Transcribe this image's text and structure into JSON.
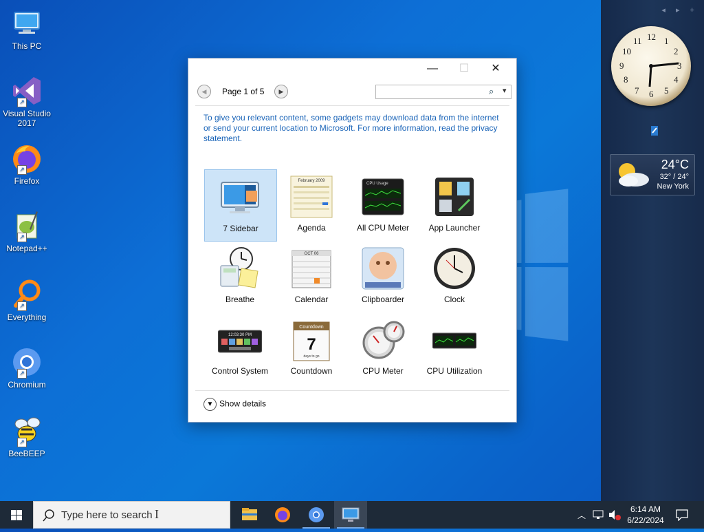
{
  "desktop": {
    "icons": [
      {
        "label": "This PC"
      },
      {
        "label": "Visual Studio 2017"
      },
      {
        "label": "Firefox"
      },
      {
        "label": "Notepad++"
      },
      {
        "label": "Everything"
      },
      {
        "label": "Chromium"
      },
      {
        "label": "BeeBEEP"
      }
    ]
  },
  "sidebar": {
    "nav": "◂ ▸ +",
    "weather": {
      "temp": "24°C",
      "range": "32° / 24°",
      "city": "New York"
    }
  },
  "dialog": {
    "minimize": "—",
    "maximize": "☐",
    "close": "✕",
    "pager": {
      "label": "Page 1 of 5",
      "prev": "◀",
      "next": "▶"
    },
    "search": {
      "placeholder": "",
      "icon": "⌕",
      "dropdown": "▾"
    },
    "info_text": "To give you relevant content, some gadgets may download data from the internet or send your current location to Microsoft. For more information, read the privacy statement.",
    "gadgets": [
      {
        "label": "7 Sidebar"
      },
      {
        "label": "Agenda"
      },
      {
        "label": "All CPU Meter"
      },
      {
        "label": "App Launcher"
      },
      {
        "label": "Breathe"
      },
      {
        "label": "Calendar"
      },
      {
        "label": "Clipboarder"
      },
      {
        "label": "Clock"
      },
      {
        "label": "Control System"
      },
      {
        "label": "Countdown"
      },
      {
        "label": "CPU Meter"
      },
      {
        "label": "CPU Utilization"
      }
    ],
    "show_details": "Show details",
    "thumbs": {
      "agenda_month": "February 2009",
      "calendar_month": "OCT 06",
      "countdown_title": "Countdown",
      "countdown_num": "7",
      "countdown_sub": "days to go",
      "control_time": "12:03:30 PM",
      "cpu_title": "CPU Usage"
    }
  },
  "taskbar": {
    "search_placeholder": "Type here to search",
    "time": "6:14 AM",
    "date": "6/22/2024"
  },
  "colors": {
    "desktop_bg": "#0b6fd6",
    "sidebar_bg": "#1a2f50",
    "info_link": "#1a64b8",
    "taskbar_bg": "#1e2a38",
    "selection": "#cde4f8"
  }
}
